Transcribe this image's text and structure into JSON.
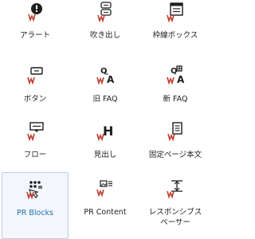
{
  "blocks": [
    {
      "label": "アラート",
      "icon": "alert-icon"
    },
    {
      "label": "吹き出し",
      "icon": "speech-bubble-icon"
    },
    {
      "label": "枠線ボックス",
      "icon": "border-box-icon"
    },
    {
      "label": "ボタン",
      "icon": "button-icon"
    },
    {
      "label": "旧 FAQ",
      "icon": "faq-old-icon"
    },
    {
      "label": "新 FAQ",
      "icon": "faq-new-icon"
    },
    {
      "label": "フロー",
      "icon": "flow-icon"
    },
    {
      "label": "見出し",
      "icon": "heading-icon"
    },
    {
      "label": "固定ページ本文",
      "icon": "fixed-page-icon"
    },
    {
      "label": "PR Blocks",
      "icon": "pr-blocks-icon",
      "selected": true
    },
    {
      "label": "PR Content",
      "icon": "pr-content-icon"
    },
    {
      "label": "レスポンシブスペーサー",
      "icon": "responsive-spacer-icon"
    }
  ],
  "colors": {
    "accent": "#2271b1",
    "mark": "#c0392b",
    "selected_bg": "#f3f7fd",
    "selected_border": "#bfcfe6"
  }
}
